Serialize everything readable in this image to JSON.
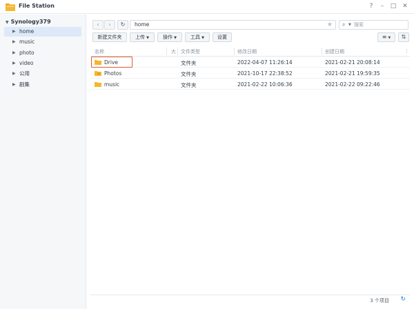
{
  "window": {
    "title": "File Station",
    "controls": {
      "help": "?",
      "minimize": "–",
      "maximize": "□",
      "close": "✕"
    }
  },
  "sidebar": {
    "root": "Synology379",
    "items": [
      {
        "label": "home",
        "active": true
      },
      {
        "label": "music"
      },
      {
        "label": "photo"
      },
      {
        "label": "video"
      },
      {
        "label": "公用"
      },
      {
        "label": "剧集"
      }
    ]
  },
  "nav": {
    "back": "‹",
    "forward": "›",
    "refresh": "↻"
  },
  "path": {
    "value": "home",
    "star": "★"
  },
  "search": {
    "placeholder": "搜索",
    "icon": "search-icon"
  },
  "toolbar": {
    "new_folder": "新建文件夹",
    "upload": "上传",
    "action": "操作",
    "tools": "工具",
    "settings": "设置"
  },
  "view": {
    "list": "≡",
    "sort": "⇅"
  },
  "columns": {
    "name": "名称",
    "size": "大",
    "type": "文件类型",
    "modified": "修改日期",
    "created": "创建日期"
  },
  "files": [
    {
      "name": "Drive",
      "type": "文件夹",
      "modified": "2022-04-07 11:26:14",
      "created": "2021-02-21 20:08:14"
    },
    {
      "name": "Photos",
      "type": "文件夹",
      "modified": "2021-10-17 22:38:52",
      "created": "2021-02-21 19:59:35"
    },
    {
      "name": "music",
      "type": "文件夹",
      "modified": "2021-02-22 10:06:36",
      "created": "2021-02-22 09:22:46"
    }
  ],
  "status": {
    "count": "3 个项目"
  },
  "colors": {
    "folder": "#f5b72a",
    "accent": "#2e7bd1",
    "highlight": "#e05a35"
  }
}
